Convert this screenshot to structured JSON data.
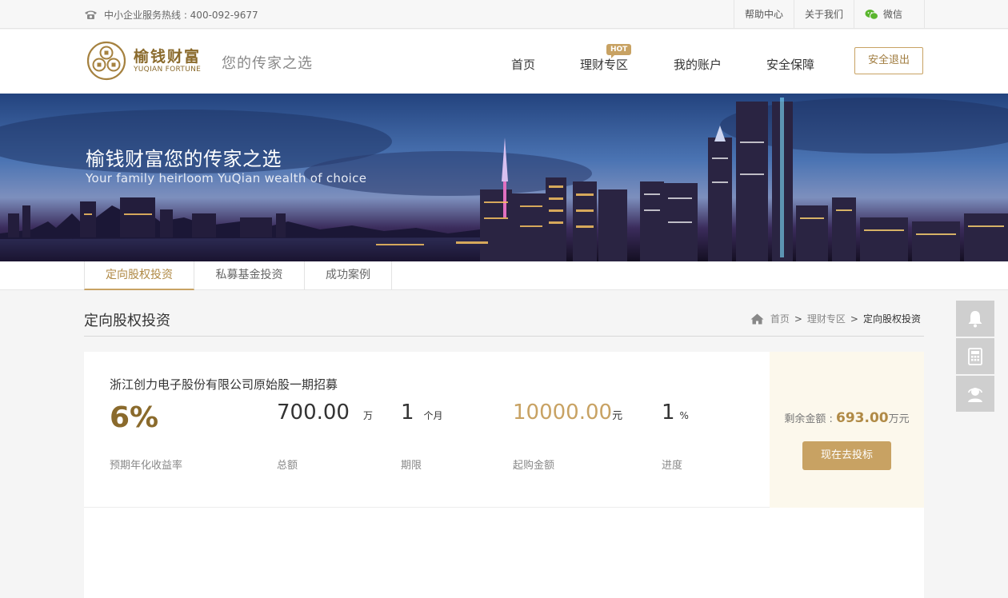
{
  "topbar": {
    "hotline": "中小企业服务热线 : 400-092-9677",
    "links": [
      "帮助中心",
      "关于我们",
      "微信"
    ]
  },
  "header": {
    "logo_cn": "榆钱财富",
    "logo_en": "YUQIAN FORTUNE",
    "slogan": "您的传家之选",
    "nav": [
      "首页",
      "理财专区",
      "我的账户",
      "安全保障"
    ],
    "hot_badge": "HOT",
    "logout_label": "安全退出"
  },
  "banner": {
    "title": "榆钱财富您的传家之选",
    "subtitle": "Your family heirloom YuQian wealth of choice"
  },
  "subtabs": [
    "定向股权投资",
    "私募基金投资",
    "成功案例"
  ],
  "section": {
    "title": "定向股权投资",
    "breadcrumb": [
      "首页",
      "理财专区",
      "定向股权投资"
    ],
    "separator": ">"
  },
  "product": {
    "name": "浙江创力电子股份有限公司原始股一期招募",
    "rate": "6%",
    "rate_label": "预期年化收益率",
    "total": "700.00",
    "total_unit": "万",
    "total_label": "总额",
    "term": "1",
    "term_unit": "个月",
    "term_label": "期限",
    "min_amount": "10000.00",
    "min_unit": "元",
    "min_label": "起购金额",
    "progress": "1",
    "progress_unit": "%",
    "progress_label": "进度",
    "remain_label": "剩余金额 :",
    "remain_value": "693.00",
    "remain_unit": "万元",
    "invest_label": "现在去投标"
  },
  "float_tools": [
    "bell-icon",
    "calculator-icon",
    "customer-service-icon"
  ],
  "colors": {
    "accent_gold": "#c8a263",
    "dark_gold": "#8a6a2c",
    "side_panel": "#fcf8ec"
  }
}
